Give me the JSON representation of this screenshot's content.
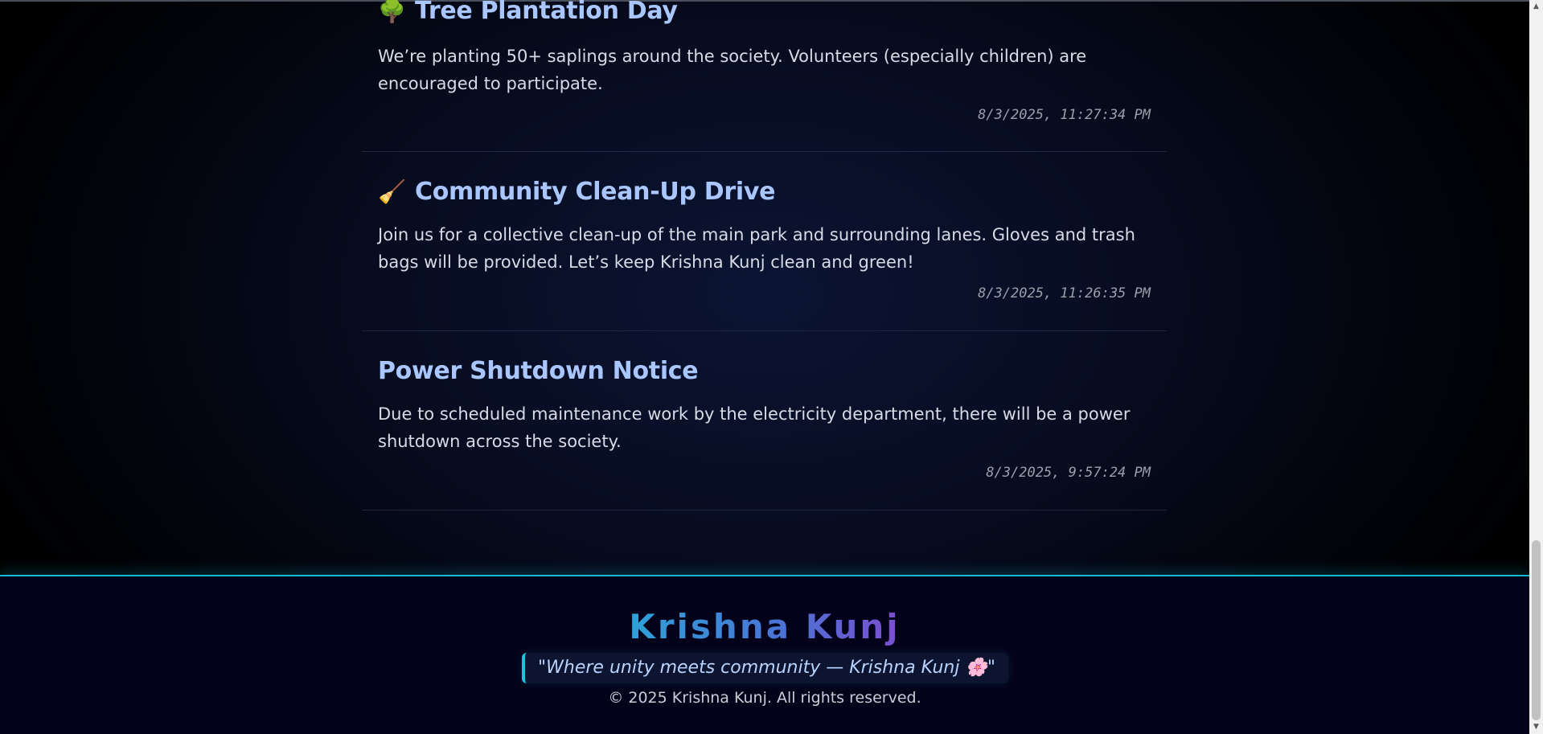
{
  "notices": [
    {
      "icon": "🌳",
      "icon_name": "tree-icon",
      "title": "Tree Plantation Day",
      "body": "We’re planting 50+ saplings around the society. Volunteers (especially children) are encouraged to participate.",
      "timestamp": "8/3/2025, 11:27:34 PM"
    },
    {
      "icon": "🧹",
      "icon_name": "broom-icon",
      "title": "Community Clean-Up Drive",
      "body": "Join us for a collective clean-up of the main park and surrounding lanes. Gloves and trash bags will be provided. Let’s keep Krishna Kunj clean and green!",
      "timestamp": "8/3/2025, 11:26:35 PM"
    },
    {
      "title": "Power Shutdown Notice",
      "body": "Due to scheduled maintenance work by the electricity department, there will be a power shutdown across the society.",
      "timestamp": "8/3/2025, 9:57:24 PM"
    }
  ],
  "footer": {
    "brand": "Krishna Kunj",
    "quote": "\"Where unity meets community — Krishna Kunj 🌸\"",
    "copyright": "© 2025 Krishna Kunj. All rights reserved."
  },
  "colors": {
    "title": "#a9c6ff",
    "footer_accent": "#17b8d4",
    "brand_gradient_start": "#2ea2d8",
    "brand_gradient_end": "#7a4ed0"
  }
}
